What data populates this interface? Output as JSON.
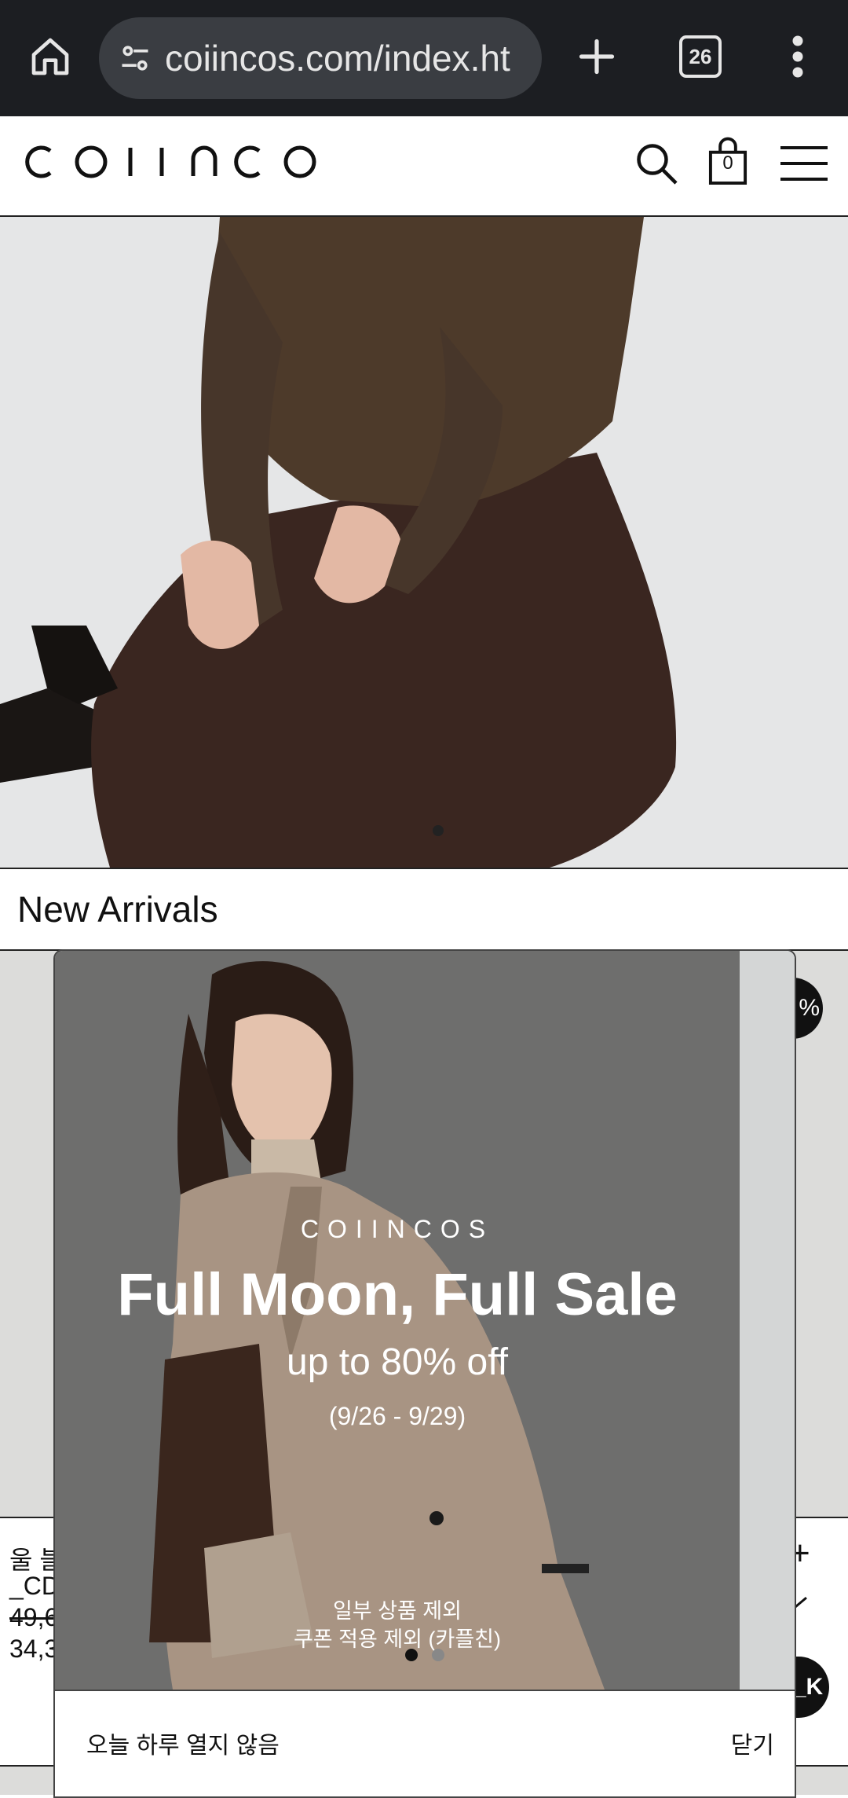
{
  "browser": {
    "url": "coiincos.com/index.ht",
    "tab_count": "26"
  },
  "site": {
    "logo": "COIINCOS",
    "cart_count": "0"
  },
  "hero": {
    "active_slide": 1
  },
  "section": {
    "title": "New Arrivals"
  },
  "product": {
    "name_line1": "울 블",
    "name_line2": "_CD",
    "price_original": "49,6",
    "price_sale": "34,3",
    "badge_top": "%",
    "badge_bottom": "_K",
    "plus_label": "+"
  },
  "popup": {
    "logo": "COIINCOS",
    "title": "Full Moon, Full Sale",
    "subtitle": "up to 80% off",
    "dates": "(9/26 - 9/29)",
    "note1": "일부 상품 제외",
    "note2": "쿠폰 적용 제외 (카플친)",
    "dont_show_today": "오늘 하루 열지 않음",
    "close": "닫기"
  }
}
